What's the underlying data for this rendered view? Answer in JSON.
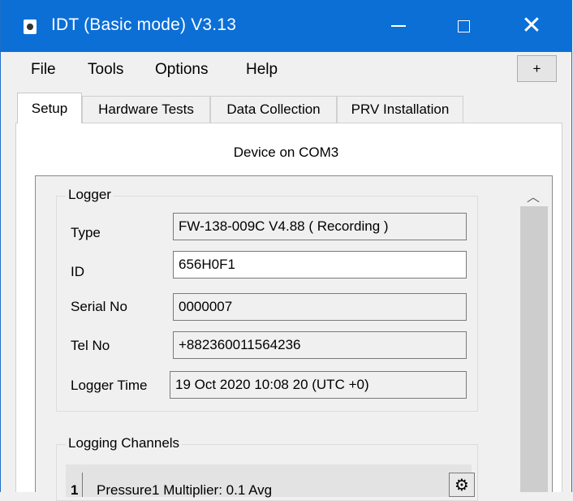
{
  "window": {
    "title": "IDT (Basic mode) V3.13",
    "icons": {
      "minimize": "minimize-icon",
      "maximize": "maximize-icon",
      "close": "close-icon"
    },
    "accent_color": "#0b6fd6"
  },
  "menu": {
    "items": [
      "File",
      "Tools",
      "Options",
      "Help"
    ],
    "plus_label": "+"
  },
  "tabs": [
    {
      "label": "Setup",
      "active": true
    },
    {
      "label": "Hardware Tests",
      "active": false
    },
    {
      "label": "Data Collection",
      "active": false
    },
    {
      "label": "PRV Installation",
      "active": false
    }
  ],
  "device_label": "Device on COM3",
  "logger": {
    "group_title": "Logger",
    "fields": [
      {
        "label": "Type",
        "value": "FW-138-009C V4.88    ( Recording )",
        "editable": false
      },
      {
        "label": "ID",
        "value": "656H0F1",
        "editable": true
      },
      {
        "label": "Serial No",
        "value": "0000007",
        "editable": false
      },
      {
        "label": "Tel No",
        "value": "+882360011564236",
        "editable": false
      },
      {
        "label": "Logger Time",
        "value": "19 Oct 2020    10:08 20  (UTC +0)",
        "editable": false
      }
    ]
  },
  "logging_channels": {
    "group_title": "Logging Channels",
    "rows": [
      {
        "number": "1",
        "text": "Pressure1  Multiplier: 0.1  Avg",
        "icon": "gear-icon"
      }
    ]
  },
  "scrollbar": {
    "up_icon": "chevron-up-icon"
  }
}
